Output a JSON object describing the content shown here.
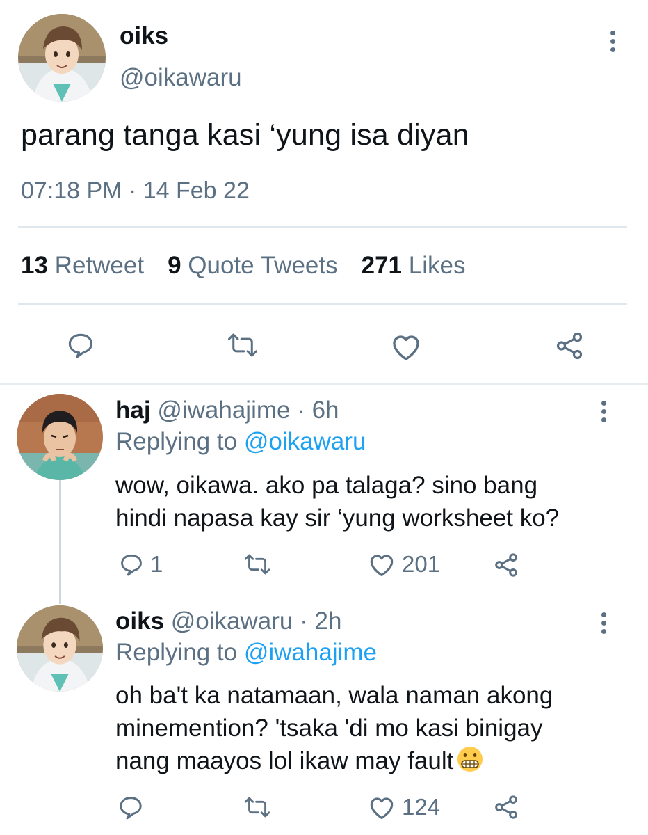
{
  "main_tweet": {
    "name": "oiks",
    "handle": "@oikawaru",
    "text": "parang tanga kasi ‘yung isa diyan",
    "timestamp": "07:18 PM · 14 Feb 22",
    "stats": {
      "retweets_count": "13",
      "retweets_label": "Retweet",
      "quotes_count": "9",
      "quotes_label": "Quote Tweets",
      "likes_count": "271",
      "likes_label": "Likes"
    }
  },
  "replies": [
    {
      "name": "haj",
      "handle": "@iwahajime",
      "time": "· 6h",
      "replying_label": "Replying to",
      "replying_to": "@oikawaru",
      "text_lines": [
        "wow, oikawa. ako pa talaga? sino bang",
        "hindi napasa kay sir ‘yung worksheet ko?"
      ],
      "reply_count": "1",
      "like_count": "201"
    },
    {
      "name": "oiks",
      "handle": "@oikawaru",
      "time": "· 2h",
      "replying_label": "Replying to",
      "replying_to": "@iwahajime",
      "text_lines": [
        "oh ba't ka natamaan, wala naman akong",
        "minemention? 'tsaka 'di mo kasi binigay",
        "nang maayos lol ikaw may fault"
      ],
      "emoji": "grimacing-face-emoji",
      "like_count": "124"
    }
  ],
  "icons": [
    "reply-icon",
    "retweet-icon",
    "like-icon",
    "share-icon",
    "more-icon"
  ],
  "colors": {
    "text": "#0f1419",
    "secondary": "#5b7083",
    "accent": "#1da1f2",
    "divider": "#e1e8ed"
  }
}
